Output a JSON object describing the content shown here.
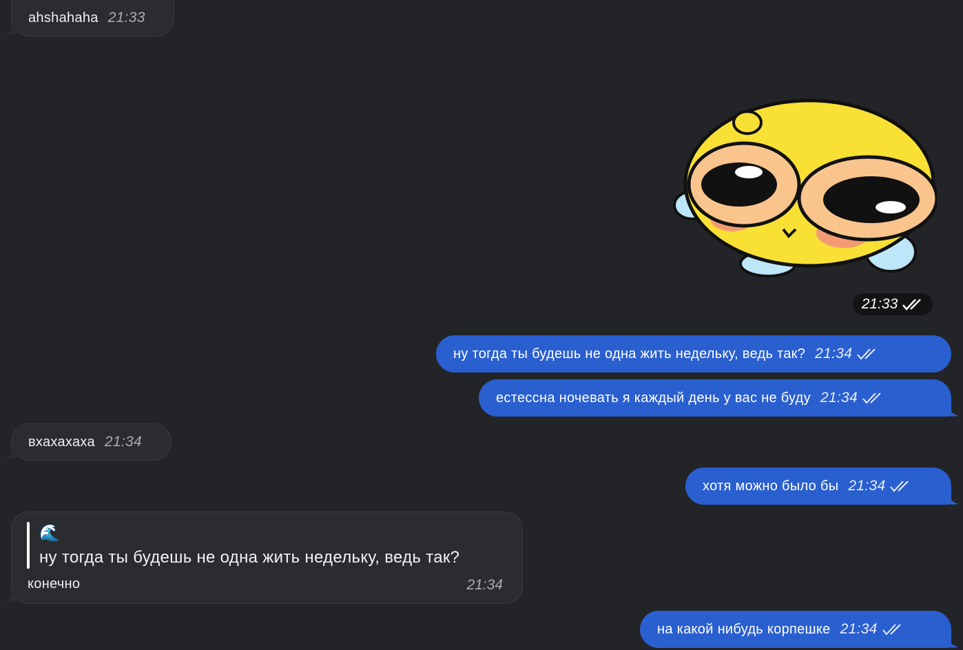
{
  "messages": [
    {
      "text": "ahshahaha",
      "time": "21:33"
    },
    {
      "sticker": "crying-yellow-blob-sticker",
      "time": "21:33"
    },
    {
      "text": "ну тогда ты будешь не одна жить недельку, ведь так?",
      "time": "21:34"
    },
    {
      "text": "естессна ночевать я каждый день у вас не буду",
      "time": "21:34"
    },
    {
      "text": "вхахахаха",
      "time": "21:34"
    },
    {
      "text": "хотя можно было бы",
      "time": "21:34"
    },
    {
      "reply_icon": "🌊",
      "reply_quote": "ну тогда ты будешь не одна жить недельку, ведь так?",
      "text": "конечно",
      "time": "21:34"
    },
    {
      "text": "на какой нибудь корпешке",
      "time": "21:34"
    }
  ],
  "colors": {
    "background": "#222427",
    "incoming": "#2b2c2f",
    "outgoing": "#2a5fd0"
  }
}
